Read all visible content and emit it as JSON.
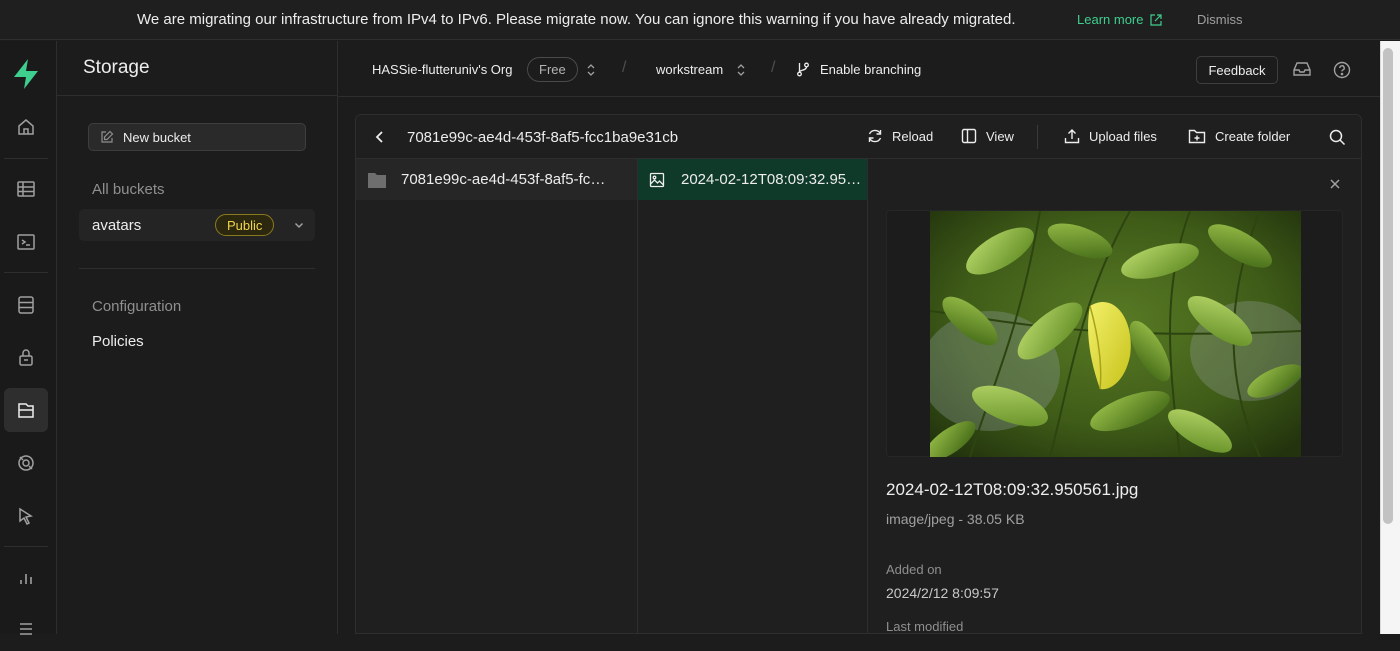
{
  "banner": {
    "message": "We are migrating our infrastructure from IPv4 to IPv6. Please migrate now. You can ignore this warning if you have already migrated.",
    "learn_more": "Learn more",
    "dismiss": "Dismiss"
  },
  "colors": {
    "brand": "#3ecf8e",
    "public_badge": "#f1d34a",
    "selected_row": "#0f3a29"
  },
  "rail": {
    "icons": [
      "home-icon",
      "table-editor-icon",
      "sql-editor-icon",
      "database-icon",
      "auth-icon",
      "storage-icon",
      "realtime-icon",
      "edge-functions-icon",
      "reports-icon",
      "logs-icon"
    ]
  },
  "sidebar": {
    "title": "Storage",
    "new_bucket": "New bucket",
    "all_buckets": "All buckets",
    "buckets": [
      {
        "name": "avatars",
        "badge": "Public"
      }
    ],
    "links": [
      "Configuration",
      "Policies"
    ]
  },
  "header": {
    "org": "HASSie-flutteruniv's Org",
    "plan": "Free",
    "project": "workstream",
    "branching": "Enable branching",
    "feedback": "Feedback"
  },
  "explorer": {
    "path": "7081e99c-ae4d-453f-8af5-fcc1ba9e31cb",
    "actions": {
      "reload": "Reload",
      "view": "View",
      "upload": "Upload files",
      "create_folder": "Create folder"
    },
    "columns": [
      {
        "item": "7081e99c-ae4d-453f-8af5-fcc1ba9e31cb",
        "type": "folder"
      },
      {
        "item": "2024-02-12T08:09:32.950561.jpg",
        "type": "file"
      }
    ]
  },
  "preview": {
    "file_name": "2024-02-12T08:09:32.950561.jpg",
    "meta": "image/jpeg - 38.05 KB",
    "added_label": "Added on",
    "added_value": "2024/2/12 8:09:57",
    "modified_label": "Last modified"
  }
}
